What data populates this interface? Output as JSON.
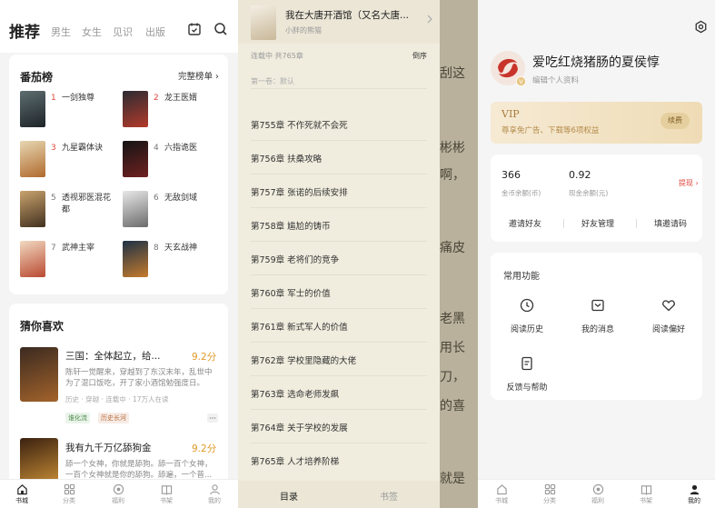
{
  "bookstore": {
    "tabs": {
      "main": "推荐",
      "t1": "男生",
      "t2": "女生",
      "t3": "见识",
      "t4": "出版"
    },
    "ranking": {
      "title": "番茄榜",
      "more": "完整榜单 ›",
      "items": [
        {
          "num": "1",
          "name": "一剑独尊",
          "num_color": "#e0463c"
        },
        {
          "num": "2",
          "name": "龙王医婿",
          "num_color": "#e0463c"
        },
        {
          "num": "3",
          "name": "九星霸体诀",
          "num_color": "#e0463c"
        },
        {
          "num": "4",
          "name": "六指诡医",
          "num_color": "#777777"
        },
        {
          "num": "5",
          "name": "透视邪医混花都",
          "num_color": "#777777"
        },
        {
          "num": "6",
          "name": "无敌剑域",
          "num_color": "#777777"
        },
        {
          "num": "7",
          "name": "武神主宰",
          "num_color": "#777777"
        },
        {
          "num": "8",
          "name": "天玄战神",
          "num_color": "#777777"
        }
      ]
    },
    "guess": {
      "title": "猜你喜欢",
      "books": [
        {
          "title": "三国：全体起立，给...",
          "score": "9.2分",
          "desc1": "陈轩一觉醒来，穿越到了东汉末年，乱世中",
          "desc2": "为了混口饭吃，开了家小酒馆勉强度日。",
          "meta": "历史 · 穿越 · 连载中 · 17万人在读",
          "tag1": "谁化流",
          "tag2": "历史长河"
        },
        {
          "title": "我有九千万亿舔狗金",
          "score": "9.2分",
          "desc1": "舔一个女神，你就是舔狗。舔一百个女神，",
          "desc2": "一百个女神就是你的舔狗。舔遍，一个普..."
        }
      ]
    },
    "nav": [
      "书城",
      "分类",
      "福利",
      "书架",
      "我的"
    ]
  },
  "catalog": {
    "book_title": "我在大唐开酒馆（又名大唐...",
    "author": "小胖的熊猫",
    "status": "连载中 共765章",
    "sort": "倒序",
    "volume": "第一卷：默认",
    "chapters": [
      "第755章 不作死就不会死",
      "第756章 扶桑攻略",
      "第757章 张诺的后续安排",
      "第758章 尴尬的铸币",
      "第759章 老将们的竞争",
      "第760章 军士的价值",
      "第761章 新式军人的价值",
      "第762章 学校里隐藏的大佬",
      "第763章 选命老师发飙",
      "第764章 关于学校的发展",
      "第765章 人才培养阶梯"
    ],
    "tab_toc": "目录",
    "tab_bookmark": "书签",
    "reader_text": [
      "刮这",
      "彬彬",
      "啊，",
      "痛皮",
      "老黑",
      "用长",
      "刀，",
      "的喜",
      "就是"
    ]
  },
  "profile": {
    "name": "爱吃红烧猪肠的夏侯惇",
    "edit": "编辑个人资料",
    "vip_title": "VIP",
    "vip_sub": "尊享免广告、下载等6项权益",
    "vip_btn": "续费",
    "coins_value": "366",
    "coins_label": "金币余额(币)",
    "cash_value": "0.92",
    "cash_label": "现金余额(元)",
    "withdraw": "提现 ›",
    "op1": "邀请好友",
    "op2": "好友管理",
    "op3": "填邀请码",
    "functions_title": "常用功能",
    "fn1": "阅读历史",
    "fn2": "我的消息",
    "fn3": "阅读偏好",
    "fn4": "反馈与帮助",
    "nav": [
      "书城",
      "分类",
      "福利",
      "书架",
      "我的"
    ]
  }
}
